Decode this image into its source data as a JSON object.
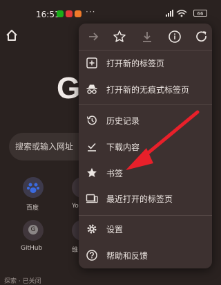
{
  "status_bar": {
    "time": "16:51",
    "overflow": "···",
    "battery": "66"
  },
  "background_page": {
    "logo_letter": "G",
    "search_placeholder": "搜索或输入网址",
    "shortcuts": [
      {
        "label": "百度"
      },
      {
        "label": "Yo"
      },
      {
        "label": "GitHub"
      },
      {
        "label": "维"
      }
    ],
    "github_letter": "G",
    "footer_text": "探索 · 已关闭"
  },
  "menu": {
    "toolbar": [
      "forward-icon",
      "star-icon",
      "download-icon",
      "info-icon",
      "refresh-icon"
    ],
    "items": [
      {
        "label": "打开新的标签页",
        "icon": "new-tab-icon"
      },
      {
        "label": "打开新的无痕式标签页",
        "icon": "incognito-icon"
      },
      {
        "label": "历史记录",
        "icon": "history-icon"
      },
      {
        "label": "下载内容",
        "icon": "downloads-icon"
      },
      {
        "label": "书签",
        "icon": "bookmark-star-icon"
      },
      {
        "label": "最近打开的标签页",
        "icon": "recent-tabs-icon"
      },
      {
        "label": "设置",
        "icon": "settings-gear-icon"
      },
      {
        "label": "帮助和反馈",
        "icon": "help-icon"
      }
    ]
  },
  "colors": {
    "background": "#2a2220",
    "menu": "#3d3130",
    "annotation_arrow": "#e8202a"
  }
}
